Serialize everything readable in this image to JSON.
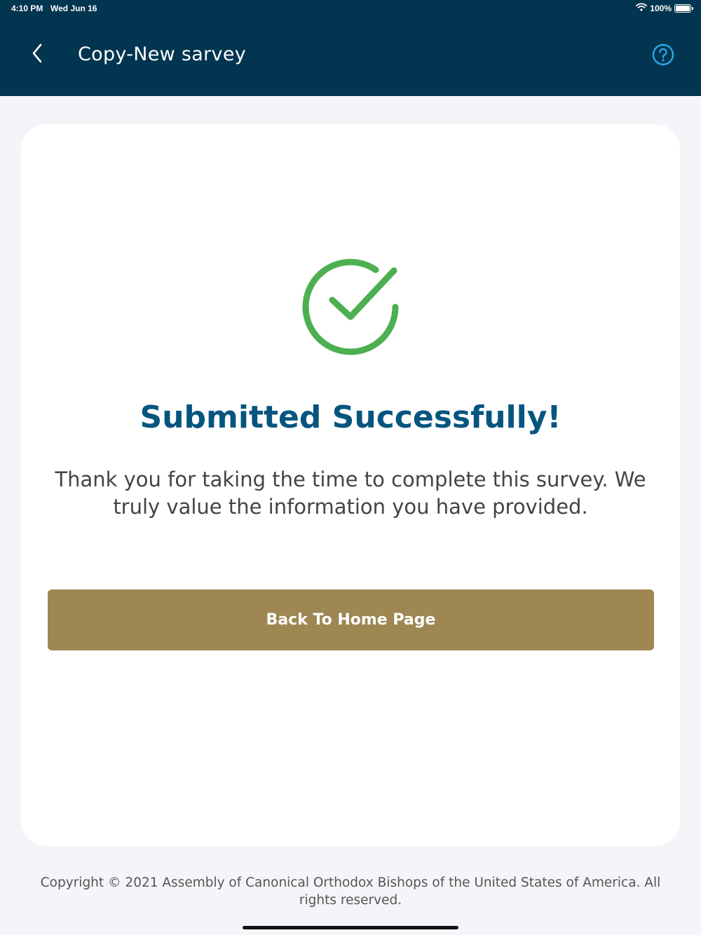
{
  "status_bar": {
    "time": "4:10 PM",
    "date": "Wed Jun 16",
    "battery": "100%"
  },
  "header": {
    "title": "Copy-New sarvey",
    "back_icon": "chevron-left-icon",
    "help_icon": "question-circle-icon"
  },
  "main": {
    "success_icon": "checkmark-circle-icon",
    "title": "Submitted Successfully!",
    "message": "Thank you for taking the time to complete this survey. We truly value the information you have provided.",
    "home_button_label": "Back To Home Page"
  },
  "footer": {
    "copyright": "Copyright © 2021 Assembly of Canonical Orthodox Bishops of the United States of America. All rights reserved."
  },
  "colors": {
    "header_bg": "#02354f",
    "accent_blue": "#06557f",
    "help_icon": "#29a8e8",
    "success_green": "#4caf50",
    "button_gold": "#9e8753",
    "page_bg": "#f4f5f8"
  }
}
